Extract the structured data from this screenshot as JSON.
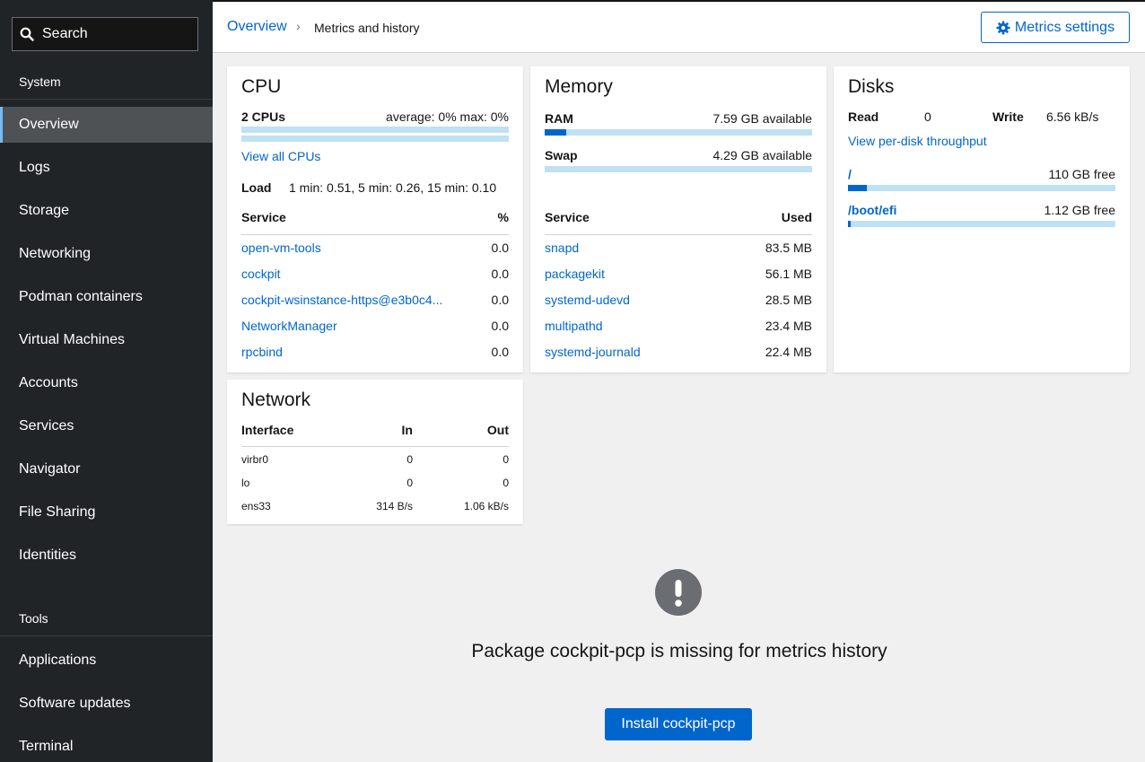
{
  "sidebar": {
    "search_label": "Search",
    "system_title": "System",
    "system_items": [
      {
        "label": "Overview",
        "active": true
      },
      {
        "label": "Logs"
      },
      {
        "label": "Storage"
      },
      {
        "label": "Networking"
      },
      {
        "label": "Podman containers"
      },
      {
        "label": "Virtual Machines"
      },
      {
        "label": "Accounts"
      },
      {
        "label": "Services"
      },
      {
        "label": "Navigator"
      },
      {
        "label": "File Sharing"
      },
      {
        "label": "Identities"
      }
    ],
    "tools_title": "Tools",
    "tools_items": [
      {
        "label": "Applications"
      },
      {
        "label": "Software updates"
      },
      {
        "label": "Terminal"
      }
    ]
  },
  "breadcrumb": {
    "parent": "Overview",
    "current": "Metrics and history"
  },
  "settings_button": "Metrics settings",
  "cpu": {
    "title": "CPU",
    "count": "2 CPUs",
    "summary": "average: 0% max: 0%",
    "usage_fraction": 0,
    "view_all": "View all CPUs",
    "load_label": "Load",
    "load_value": "1 min: 0.51, 5 min: 0.26, 15 min: 0.10",
    "col_service": "Service",
    "col_value": "%",
    "services": [
      {
        "name": "open-vm-tools",
        "value": "0.0"
      },
      {
        "name": "cockpit",
        "value": "0.0"
      },
      {
        "name": "cockpit-wsinstance-https@e3b0c4...",
        "value": "0.0"
      },
      {
        "name": "NetworkManager",
        "value": "0.0"
      },
      {
        "name": "rpcbind",
        "value": "0.0"
      }
    ]
  },
  "memory": {
    "title": "Memory",
    "ram_label": "RAM",
    "ram_value": "7.59 GB available",
    "ram_used_fraction": 0.08,
    "swap_label": "Swap",
    "swap_value": "4.29 GB available",
    "swap_used_fraction": 0,
    "col_service": "Service",
    "col_value": "Used",
    "services": [
      {
        "name": "snapd",
        "value": "83.5 MB"
      },
      {
        "name": "packagekit",
        "value": "56.1 MB"
      },
      {
        "name": "systemd-udevd",
        "value": "28.5 MB"
      },
      {
        "name": "multipathd",
        "value": "23.4 MB"
      },
      {
        "name": "systemd-journald",
        "value": "22.4 MB"
      }
    ]
  },
  "disks": {
    "title": "Disks",
    "read_label": "Read",
    "read_value": "0",
    "write_label": "Write",
    "write_value": "6.56 kB/s",
    "view_link": "View per-disk throughput",
    "mounts": [
      {
        "name": "/",
        "free": "110 GB free",
        "used_fraction": 0.07
      },
      {
        "name": "/boot/efi",
        "free": "1.12 GB free",
        "used_fraction": 0.01
      }
    ]
  },
  "network": {
    "title": "Network",
    "col_interface": "Interface",
    "col_in": "In",
    "col_out": "Out",
    "rows": [
      {
        "iface": "virbr0",
        "in": "0",
        "out": "0"
      },
      {
        "iface": "lo",
        "in": "0",
        "out": "0"
      },
      {
        "iface": "ens33",
        "in": "314 B/s",
        "out": "1.06 kB/s"
      }
    ]
  },
  "empty_state": {
    "title": "Package cockpit-pcp is missing for metrics history",
    "button": "Install cockpit-pcp"
  }
}
